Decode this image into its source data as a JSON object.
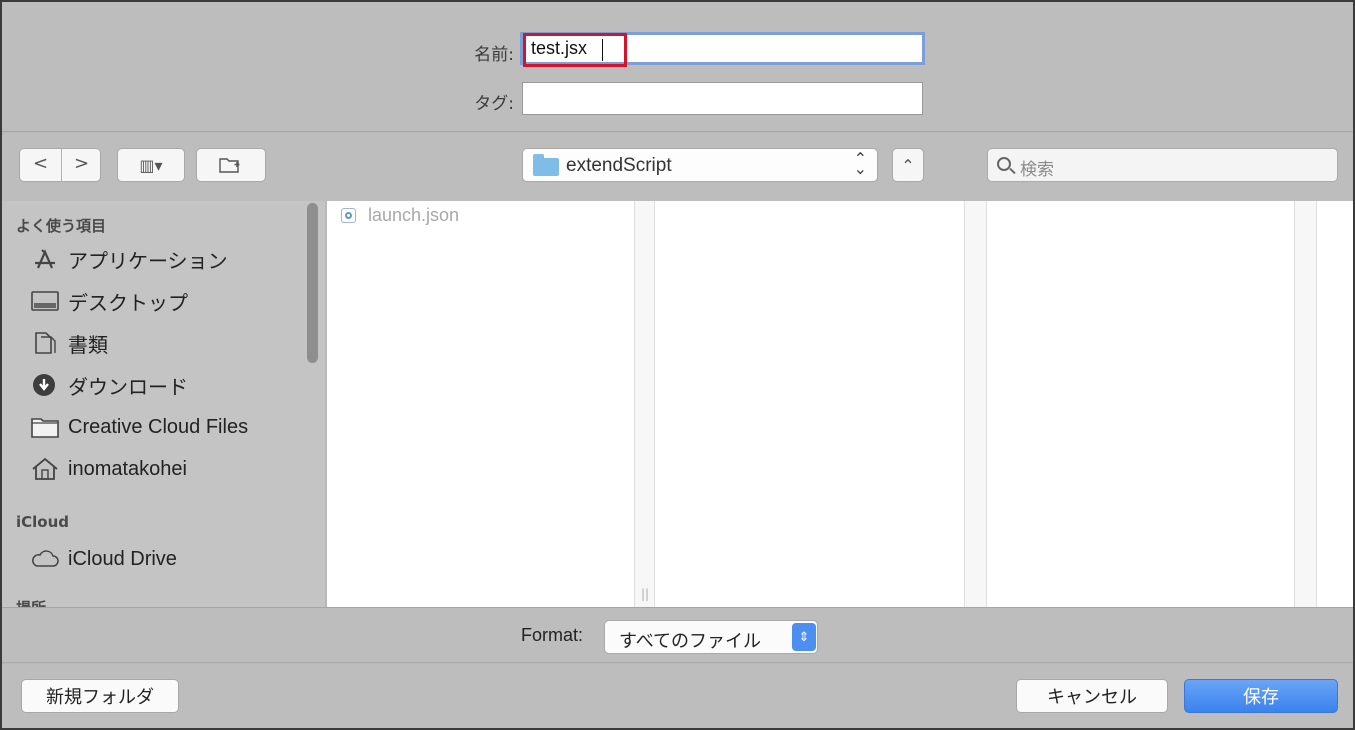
{
  "header": {
    "name_label": "名前:",
    "name_value": "test.jsx",
    "tags_label": "タグ:"
  },
  "toolbar": {
    "back_glyph": "<",
    "forward_glyph": ">",
    "view_glyph": "▥▾",
    "path": "extendScript",
    "search_placeholder": "検索"
  },
  "sidebar": {
    "sections": [
      {
        "title": "よく使う項目"
      },
      {
        "title": "iCloud"
      },
      {
        "title": "場所"
      }
    ],
    "favorites": [
      {
        "label": "アプリケーション",
        "icon": "applications-icon"
      },
      {
        "label": "デスクトップ",
        "icon": "desktop-icon"
      },
      {
        "label": "書類",
        "icon": "documents-icon"
      },
      {
        "label": "ダウンロード",
        "icon": "downloads-icon"
      },
      {
        "label": "Creative Cloud Files",
        "icon": "folder-icon"
      },
      {
        "label": "inomatakohei",
        "icon": "home-icon"
      }
    ],
    "icloud": [
      {
        "label": "iCloud Drive",
        "icon": "cloud-icon"
      }
    ]
  },
  "browser": {
    "files": [
      {
        "name": "launch.json",
        "icon": "json-file-icon"
      }
    ]
  },
  "format": {
    "label": "Format:",
    "value": "すべてのファイル"
  },
  "buttons": {
    "new_folder": "新規フォルダ",
    "cancel": "キャンセル",
    "save": "保存"
  },
  "colors": {
    "accent": "#3b82ee",
    "highlight": "#d4142a",
    "folder": "#7fbde8"
  }
}
